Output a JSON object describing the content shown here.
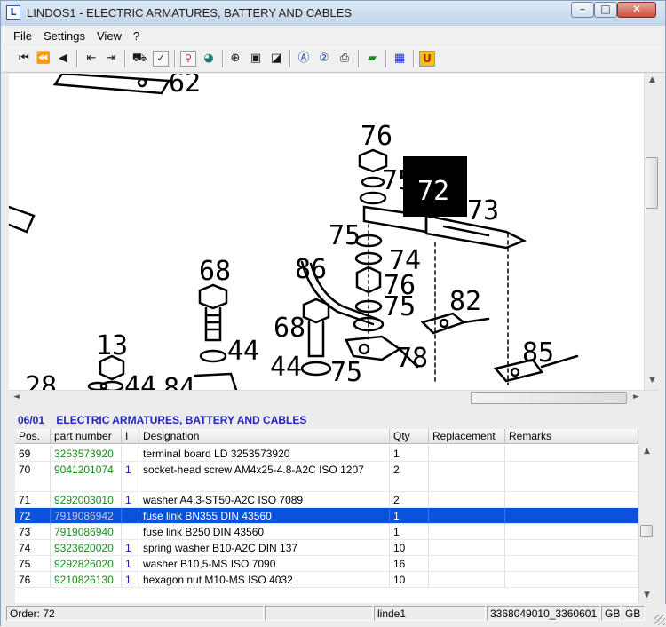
{
  "window": {
    "title": "LINDOS1 - ELECTRIC ARMATURES, BATTERY AND CABLES",
    "app_icon": "L",
    "minimize_glyph": "–",
    "maximize_glyph": "□",
    "close_glyph": "✕"
  },
  "menu": [
    "File",
    "Settings",
    "View",
    "?"
  ],
  "toolbar": {
    "icons": [
      "first-icon",
      "previous-page-icon",
      "previous-icon",
      "book-back-icon",
      "book-forward-icon",
      "cart-icon",
      "checklist-icon",
      "link-icon",
      "globe-icon",
      "zoom-icon",
      "page-icon",
      "page-alt-icon",
      "a-circle-icon",
      "q-circle-icon",
      "printer-icon",
      "green-book-icon",
      "blue-grid-icon",
      "u-icon"
    ],
    "u_label": "U"
  },
  "drawing": {
    "labels": [
      "62",
      "76",
      "75",
      "72",
      "73",
      "75",
      "74",
      "76",
      "75",
      "82",
      "68",
      "86",
      "68",
      "13",
      "44",
      "44",
      "75",
      "78",
      "85",
      "28",
      "44",
      "84"
    ]
  },
  "group": {
    "code": "06/01",
    "title": "ELECTRIC ARMATURES, BATTERY AND CABLES"
  },
  "table": {
    "columns": [
      "Pos.",
      "part number",
      "I",
      "Designation",
      "Qty",
      "Replacement",
      "Remarks"
    ],
    "rows": [
      {
        "pos": "69",
        "part": "3253573920",
        "ind": "",
        "desc": "terminal board   LD 3253573920",
        "qty": "1",
        "selected": false
      },
      {
        "pos": "70",
        "part": "9041201074",
        "ind": "1",
        "desc": "socket-head screw AM4x25-4.8-A2C  ISO 1207",
        "qty": "2",
        "selected": false
      },
      {
        "pos": "71",
        "part": "9292003010",
        "ind": "1",
        "desc": "washer A4,3-ST50-A2C  ISO 7089",
        "qty": "2",
        "selected": false
      },
      {
        "pos": "72",
        "part": "7919086942",
        "ind": "",
        "desc": "fuse link BN355  DIN 43560",
        "qty": "1",
        "selected": true
      },
      {
        "pos": "73",
        "part": "7919086940",
        "ind": "",
        "desc": "fuse link B250  DIN 43560",
        "qty": "1",
        "selected": false
      },
      {
        "pos": "74",
        "part": "9323620020",
        "ind": "1",
        "desc": "spring washer B10-A2C  DIN 137",
        "qty": "10",
        "selected": false
      },
      {
        "pos": "75",
        "part": "9292826020",
        "ind": "1",
        "desc": "washer B10,5-MS  ISO 7090",
        "qty": "16",
        "selected": false
      },
      {
        "pos": "76",
        "part": "9210826130",
        "ind": "1",
        "desc": "hexagon nut M10-MS  ISO 4032",
        "qty": "10",
        "selected": false
      }
    ]
  },
  "status": {
    "order": "Order: 72",
    "blank": "",
    "user": "linde1",
    "id": "3368049010_3360601",
    "lang1": "GB",
    "lang2": "GB"
  },
  "scroll": {
    "up": "▲",
    "down": "▼",
    "left": "◄",
    "right": "►"
  }
}
